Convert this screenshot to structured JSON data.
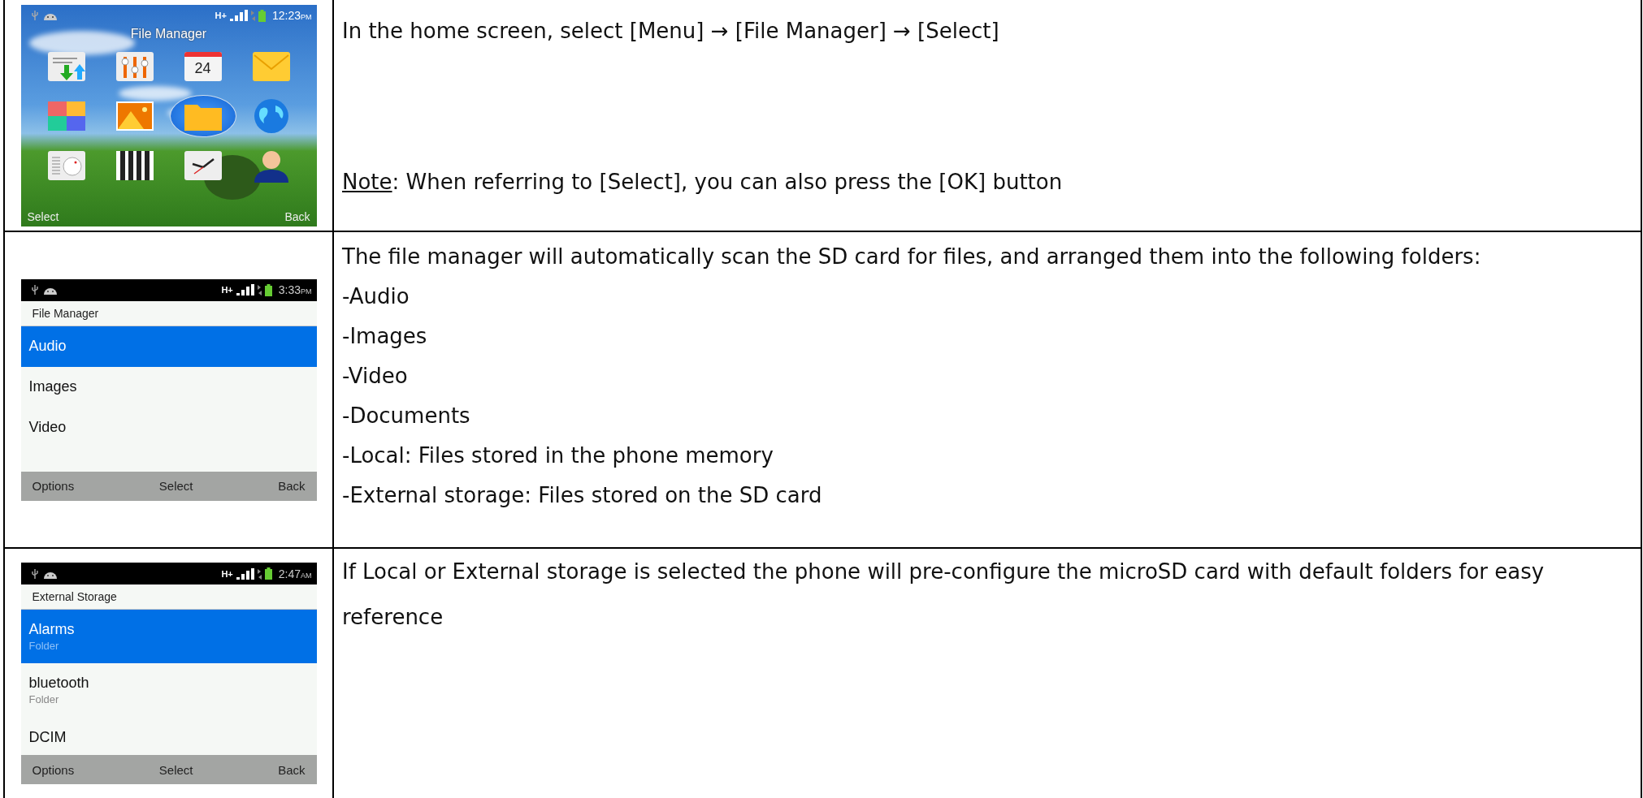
{
  "rows": [
    {
      "phone": {
        "kind": "home",
        "status": {
          "network": "H+",
          "time": "12:23",
          "ampm": "PM"
        },
        "title": "File Manager",
        "apps": [
          {
            "kind": "transfer",
            "selected": false
          },
          {
            "kind": "equalizer",
            "selected": false
          },
          {
            "kind": "calendar",
            "label": "24",
            "selected": false
          },
          {
            "kind": "mail",
            "selected": false
          },
          {
            "kind": "tiles",
            "selected": false
          },
          {
            "kind": "gallery",
            "selected": false
          },
          {
            "kind": "folder",
            "selected": true
          },
          {
            "kind": "globe",
            "selected": false
          },
          {
            "kind": "radio",
            "selected": false
          },
          {
            "kind": "piano",
            "selected": false
          },
          {
            "kind": "clock",
            "selected": false
          },
          {
            "kind": "contact",
            "selected": false
          }
        ],
        "softkeys": [
          "Select",
          "Back"
        ]
      },
      "text": {
        "paragraphs": [
          "In the home screen, select [Menu] → [File Manager] → [Select]"
        ],
        "note": {
          "label": "Note",
          "text": ": When referring to [Select], you can also press the [OK] button"
        }
      }
    },
    {
      "phone": {
        "kind": "list",
        "status": {
          "network": "H+",
          "time": "3:33",
          "ampm": "PM"
        },
        "title": "File Manager",
        "items": [
          {
            "label": "Audio",
            "selected": true
          },
          {
            "label": "Images",
            "selected": false
          },
          {
            "label": "Video",
            "selected": false
          }
        ],
        "softkeys": [
          "Options",
          "Select",
          "Back"
        ]
      },
      "text": {
        "paragraphs": [
          "The file manager will automatically scan the SD card for files, and arranged them into the following folders:"
        ],
        "items": [
          "-Audio",
          "-Images",
          "-Video",
          "-Documents",
          "-Local: Files stored in the phone memory",
          "-External storage: Files stored on the SD card"
        ]
      }
    },
    {
      "phone": {
        "kind": "list",
        "status": {
          "network": "H+",
          "time": "2:47",
          "ampm": "AM"
        },
        "title": "External Storage",
        "items": [
          {
            "label": "Alarms",
            "sublabel": "Folder",
            "selected": true
          },
          {
            "label": "bluetooth",
            "sublabel": "Folder",
            "selected": false
          },
          {
            "label": "DCIM",
            "selected": false
          }
        ],
        "softkeys": [
          "Options",
          "Select",
          "Back"
        ]
      },
      "text": {
        "paragraphs": [
          "If Local or External storage is selected the phone will pre-configure the microSD card with default folders for easy reference"
        ]
      }
    }
  ]
}
